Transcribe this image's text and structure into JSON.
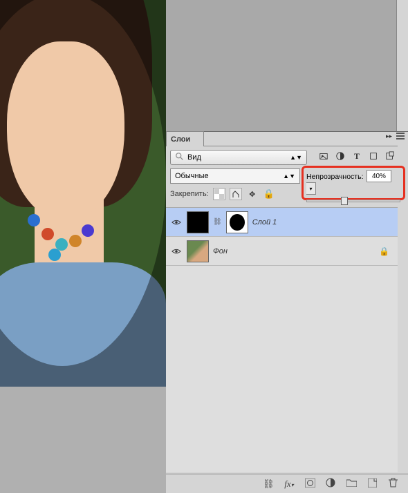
{
  "panel": {
    "title": "Слои",
    "filter_label": "Вид",
    "blend_mode": "Обычные",
    "opacity_label": "Непрозрачность:",
    "opacity_value": "40%",
    "opacity_percent": 40,
    "lock_label": "Закрепить:"
  },
  "layers": [
    {
      "name": "Слой 1",
      "has_mask": true,
      "selected": true,
      "locked": false
    },
    {
      "name": "Фон",
      "has_mask": false,
      "selected": false,
      "locked": true
    }
  ],
  "colors": {
    "highlight": "#e63020",
    "selection": "#b7cdf4",
    "panel_bg": "#d5d5d5"
  }
}
